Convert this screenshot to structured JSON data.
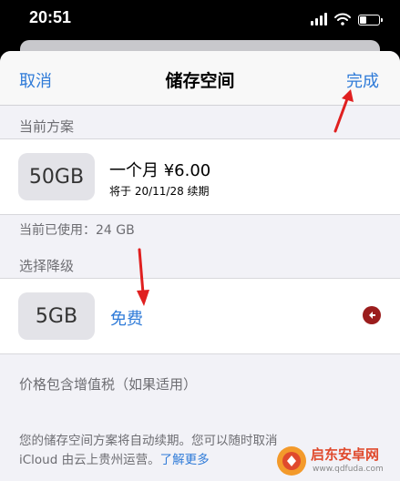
{
  "status_bar": {
    "time": "20:51"
  },
  "nav": {
    "cancel_label": "取消",
    "title": "储存空间",
    "done_label": "完成"
  },
  "current_plan": {
    "header": "当前方案",
    "tier": "50GB",
    "name": "一个月 ¥6.00",
    "renewal": "将于 20/11/28 续期",
    "used": "当前已使用：24 GB"
  },
  "downgrade": {
    "header": "选择降级",
    "tier": "5GB",
    "price_label": "免费"
  },
  "tax_note": "价格包含增值税（如果适用）",
  "footer": {
    "line1": "您的储存空间方案将自动续期。您可以随时取消",
    "line2": "iCloud 由云上贵州运营。",
    "learn_more": "了解更多"
  },
  "watermark": {
    "text": "启东安卓网",
    "url": "www.qdfuda.com"
  },
  "colors": {
    "accent": "#2f7bd8",
    "annotation_arrow": "#e02020",
    "remove_button": "#9b1d1d"
  }
}
